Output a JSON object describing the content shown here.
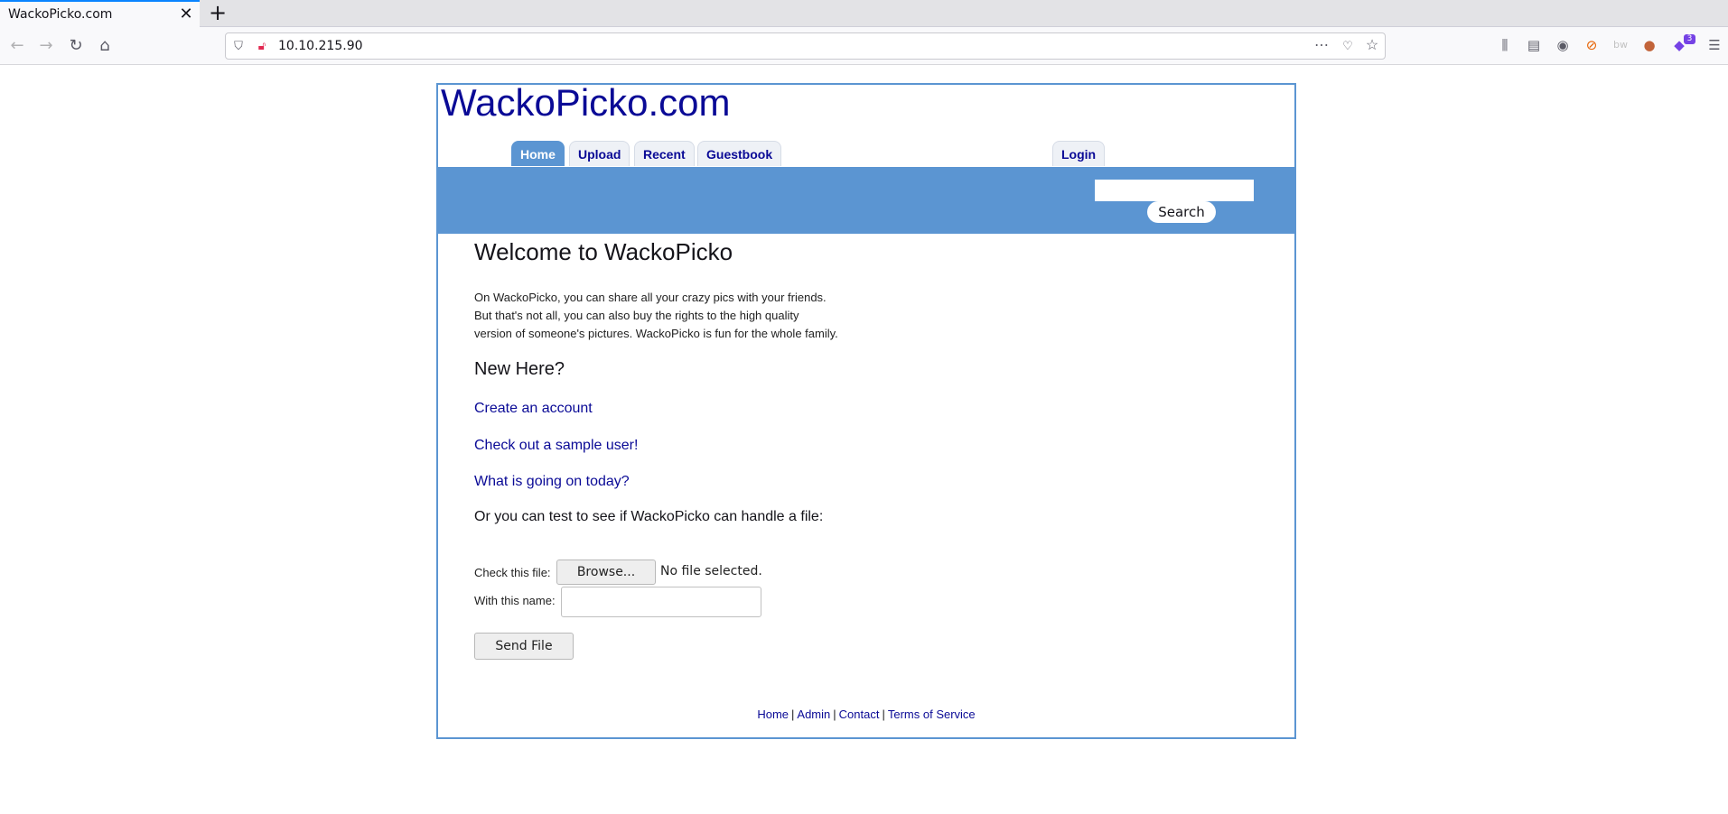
{
  "browser": {
    "tab_title": "WackoPicko.com",
    "url": "10.10.215.90",
    "extension_badge": "3"
  },
  "site": {
    "logo": "WackoPicko.com",
    "nav_tabs": [
      "Home",
      "Upload",
      "Recent",
      "Guestbook"
    ],
    "active_tab": "Home",
    "login_tab": "Login",
    "search_placeholder": "",
    "search_button": "Search"
  },
  "content": {
    "heading": "Welcome to WackoPicko",
    "intro_lines": [
      "On WackoPicko, you can share all your crazy pics with your friends.",
      "But that's not all, you can also buy the rights to the high quality",
      "version of someone's pictures. WackoPicko is fun for the whole family."
    ],
    "subheading": "New Here?",
    "links": [
      "Create an account",
      "Check out a sample user!",
      "What is going on today?"
    ],
    "file_prompt": "Or you can test to see if WackoPicko can handle a file:",
    "check_file_label": "Check this file:",
    "browse_button": "Browse...",
    "no_file_text": "No file selected.",
    "name_label": "With this name:",
    "name_value": "",
    "send_button": "Send File"
  },
  "footer": {
    "links": [
      "Home",
      "Admin",
      "Contact",
      "Terms of Service"
    ],
    "separator": "|"
  }
}
